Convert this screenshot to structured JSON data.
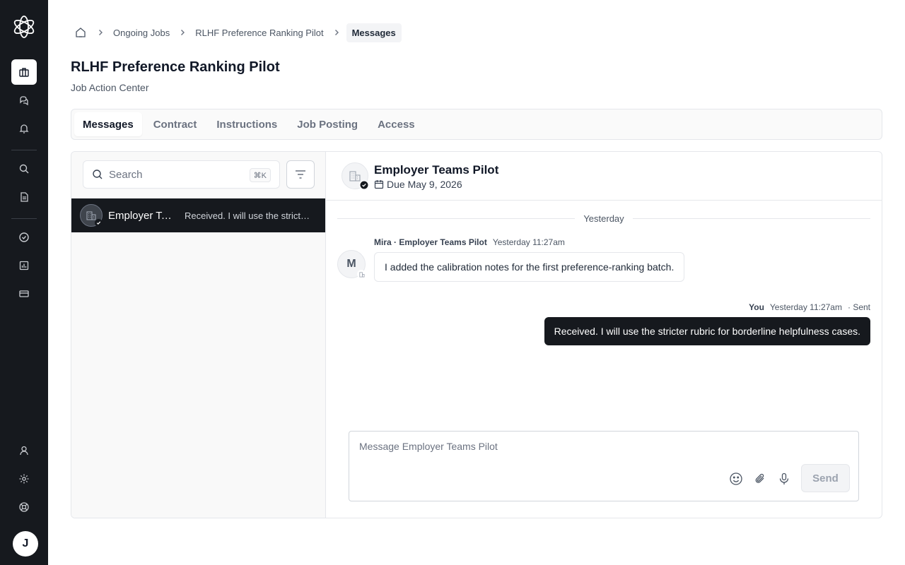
{
  "sidebar": {
    "logo": "logo-icon",
    "items": [
      {
        "icon": "briefcase-icon",
        "active": true
      },
      {
        "icon": "chat-icon",
        "active": false
      },
      {
        "icon": "bell-icon",
        "active": false
      },
      {
        "icon": "search-icon",
        "active": false
      },
      {
        "icon": "document-icon",
        "active": false
      },
      {
        "icon": "check-circle-icon",
        "active": false
      },
      {
        "icon": "chart-icon",
        "active": false
      },
      {
        "icon": "credit-card-icon",
        "active": false
      },
      {
        "icon": "user-icon",
        "active": false
      },
      {
        "icon": "gear-icon",
        "active": false
      },
      {
        "icon": "help-icon",
        "active": false
      }
    ],
    "avatar_initial": "J"
  },
  "breadcrumb": {
    "items": [
      "Ongoing Jobs",
      "RLHF Preference Ranking Pilot"
    ],
    "current": "Messages"
  },
  "page": {
    "title": "RLHF Preference Ranking Pilot",
    "subtitle": "Job Action Center"
  },
  "tabs": [
    {
      "label": "Messages",
      "active": true
    },
    {
      "label": "Contract",
      "active": false
    },
    {
      "label": "Instructions",
      "active": false
    },
    {
      "label": "Job Posting",
      "active": false
    },
    {
      "label": "Access",
      "active": false
    }
  ],
  "inbox": {
    "search_placeholder": "Search",
    "shortcut": "⌘K",
    "conversations": [
      {
        "name": "Employer Teams Pilot",
        "preview": "Received. I will use the stricter rubric for borderline helpfulness cases.",
        "selected": true
      }
    ]
  },
  "chat": {
    "name": "Employer Teams Pilot",
    "due": "Due May 9, 2026",
    "day_separator": "Yesterday",
    "messages": [
      {
        "sender": "Mira · Employer Teams Pilot",
        "time": "Yesterday 11:27am",
        "text": "I added the calibration notes for the first preference-ranking batch.",
        "initial": "M",
        "direction": "in"
      },
      {
        "sender": "You",
        "time": "Yesterday 11:27am",
        "status": "· Sent",
        "text": "Received. I will use the stricter rubric for borderline helpfulness cases.",
        "direction": "out"
      }
    ],
    "composer_placeholder": "Message Employer Teams Pilot",
    "send_label": "Send"
  },
  "colors": {
    "sidebar_bg": "#16191e",
    "selected_conv_bg": "#16191e",
    "outgoing_bubble": "#16191e"
  }
}
